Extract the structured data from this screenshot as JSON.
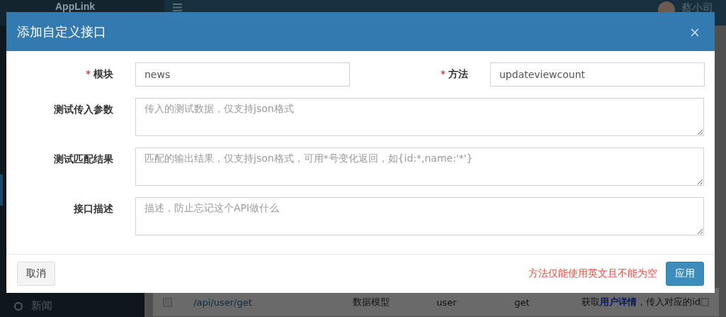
{
  "background": {
    "brand": "AppLink",
    "user_name": "蔡小司",
    "sidebar_item": "新闻",
    "table_row": {
      "checked": false,
      "path": "/api/user/get",
      "type": "数据模型",
      "module": "user",
      "method": "get",
      "description": "获取**用户详情**，传入对应的id"
    }
  },
  "dialog": {
    "title": "添加自定义接口",
    "close": "×",
    "rows": [
      [
        {
          "label": "模块",
          "marker": "*",
          "kind": "input",
          "value": "news"
        },
        {
          "label": "方法",
          "marker": "*",
          "kind": "input",
          "value": "updateviewcount"
        }
      ],
      [
        {
          "label": "测试传入参数",
          "kind": "textarea",
          "placeholder": "传入的测试数据，仅支持json格式"
        }
      ],
      [
        {
          "label": "测试匹配结果",
          "kind": "textarea",
          "placeholder": "匹配的输出结果，仅支持json格式，可用*号变化返回，如{id:*,name:'*'}"
        }
      ],
      [
        {
          "label": "接口描述",
          "kind": "textarea",
          "placeholder": "描述，防止忘记这个API做什么"
        }
      ]
    ],
    "cancel": "取消",
    "error": "方法仅能使用英文且不能为空",
    "apply": "应用"
  }
}
